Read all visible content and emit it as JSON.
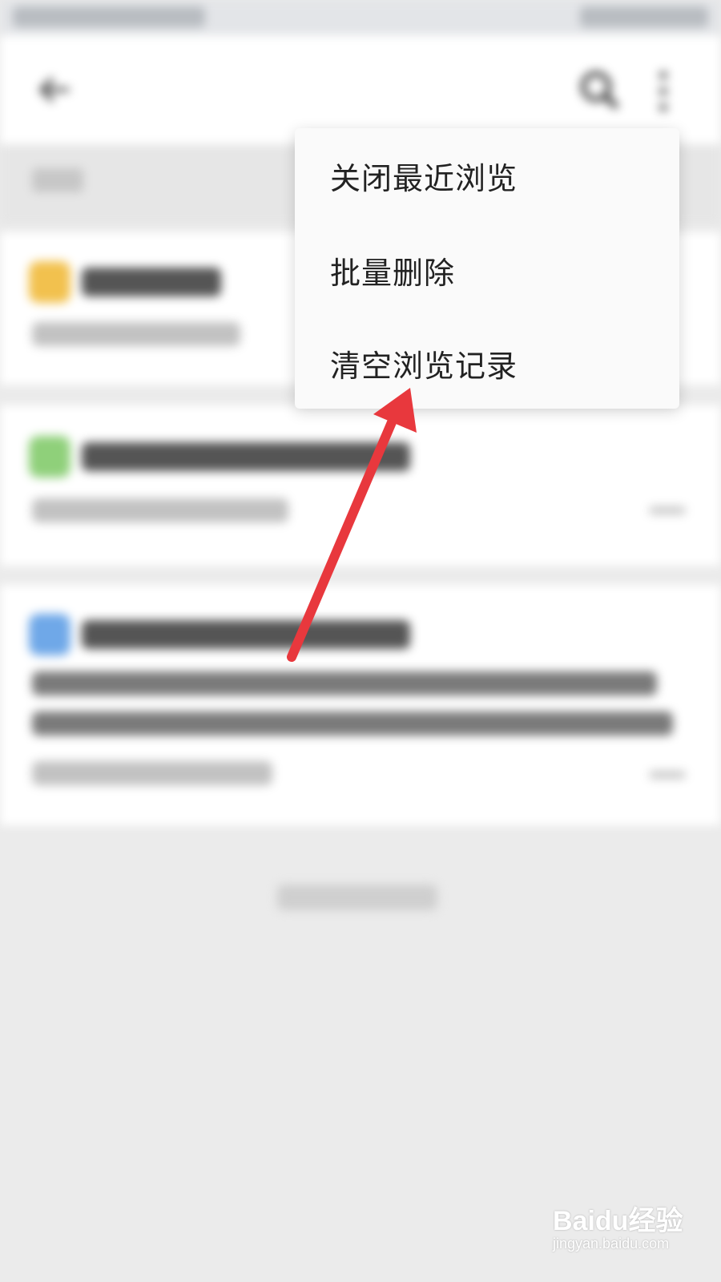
{
  "menu": {
    "items": [
      {
        "label": "关闭最近浏览"
      },
      {
        "label": "批量删除"
      },
      {
        "label": "清空浏览记录"
      }
    ]
  },
  "colors": {
    "arrow": "#e8383d",
    "menu_bg": "#fafafa",
    "page_bg": "#ebebeb",
    "card_icon_1": "#f2c14e",
    "card_icon_2": "#8fd07a",
    "card_icon_3": "#6fa8e8"
  },
  "watermark": {
    "main": "Baidu经验",
    "sub": "jingyan.baidu.com"
  }
}
